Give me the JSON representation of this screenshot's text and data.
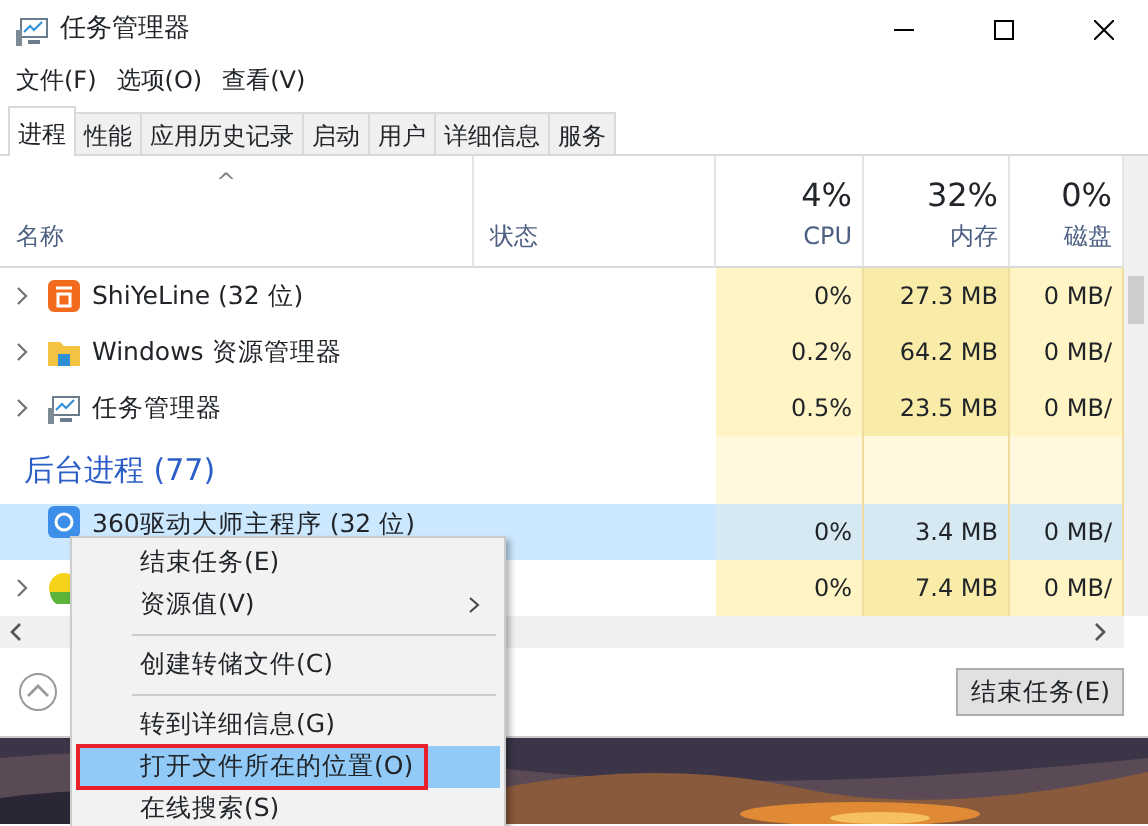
{
  "window": {
    "title": "任务管理器"
  },
  "menu": [
    "文件(F)",
    "选项(O)",
    "查看(V)"
  ],
  "tabs": [
    {
      "label": "进程",
      "selected": true
    },
    {
      "label": "性能",
      "selected": false
    },
    {
      "label": "应用历史记录",
      "selected": false
    },
    {
      "label": "启动",
      "selected": false
    },
    {
      "label": "用户",
      "selected": false
    },
    {
      "label": "详细信息",
      "selected": false
    },
    {
      "label": "服务",
      "selected": false
    }
  ],
  "columns": [
    {
      "label": "名称",
      "sort": "^"
    },
    {
      "label": "状态"
    },
    {
      "label": "CPU",
      "total": "4%"
    },
    {
      "label": "内存",
      "total": "32%"
    },
    {
      "label": "磁盘",
      "total": "0%"
    }
  ],
  "apps": [
    {
      "name": "ShiYeLine (32 位)",
      "cpu": "0%",
      "memory": "27.3 MB",
      "disk": "0 MB/"
    },
    {
      "name": "Windows 资源管理器",
      "cpu": "0.2%",
      "memory": "64.2 MB",
      "disk": "0 MB/"
    },
    {
      "name": "任务管理器",
      "cpu": "0.5%",
      "memory": "23.5 MB",
      "disk": "0 MB/"
    }
  ],
  "group": "后台进程 (77)",
  "background": [
    {
      "name": "360驱动大师主程序 (32 位)",
      "selected": true,
      "expandable": false,
      "cpu": "0%",
      "memory": "3.4 MB",
      "disk": "0 MB/"
    },
    {
      "selected": false,
      "expandable": true,
      "cpu": "0%",
      "memory": "7.4 MB",
      "disk": "0 MB/"
    }
  ],
  "end_button": "结束任务(E)",
  "context_menu": [
    {
      "kind": "item",
      "label": "结束任务(E)",
      "selected": false
    },
    {
      "kind": "submenu",
      "label": "资源值(V)",
      "selected": false
    },
    {
      "kind": "separator"
    },
    {
      "kind": "item",
      "label": "创建转储文件(C)",
      "selected": false
    },
    {
      "kind": "separator"
    },
    {
      "kind": "item",
      "label": "转到详细信息(G)",
      "selected": false
    },
    {
      "kind": "item",
      "label": "打开文件所在的位置(O)",
      "selected": true,
      "boxed": true
    },
    {
      "kind": "item",
      "label": "在线搜索(S)",
      "selected": false
    }
  ]
}
